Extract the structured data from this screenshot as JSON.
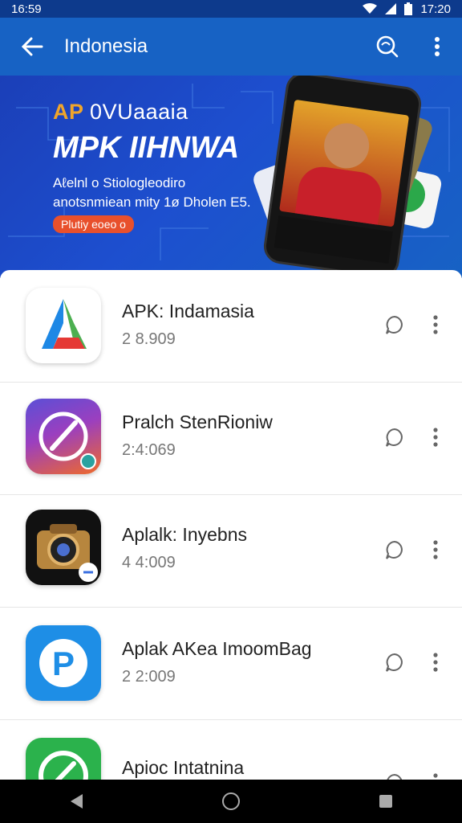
{
  "status_bar": {
    "time_left": "16:59",
    "time_right": "17:20",
    "icons": [
      "signal-icon",
      "wifi-icon",
      "battery-icon"
    ]
  },
  "app_bar": {
    "title": "Indonesia",
    "back_icon": "arrow-left-icon",
    "search_icon": "search-icon",
    "more_icon": "more-vert-icon"
  },
  "banner": {
    "line1_accent": "AP",
    "line1_rest": "0VUaaaia",
    "line2": "MPK IIHNWA",
    "line3": "Aℓelnl o Stiologleodiro",
    "line4": "anotsnmiean mity 1ø Dholen E5.",
    "pill": "Plutiy eoeo o"
  },
  "apps": [
    {
      "name": "APK: Indamasia",
      "meta": "2 8.909"
    },
    {
      "name": "Pralch StenRioniw",
      "meta": "2:4:069"
    },
    {
      "name": "Aplalk: Inyebns",
      "meta": "4 4:009"
    },
    {
      "name": "Aplak AKea ImoomBag",
      "meta": "2 2:009"
    },
    {
      "name": "Apioc Intatnina",
      "meta": ""
    }
  ],
  "colors": {
    "app_bar": "#1762c4",
    "status_bar": "#0d3a8c",
    "accent_orange": "#f0a52a"
  },
  "nav": {
    "icons": [
      "back-triangle-icon",
      "home-circle-icon",
      "recents-square-icon"
    ]
  }
}
